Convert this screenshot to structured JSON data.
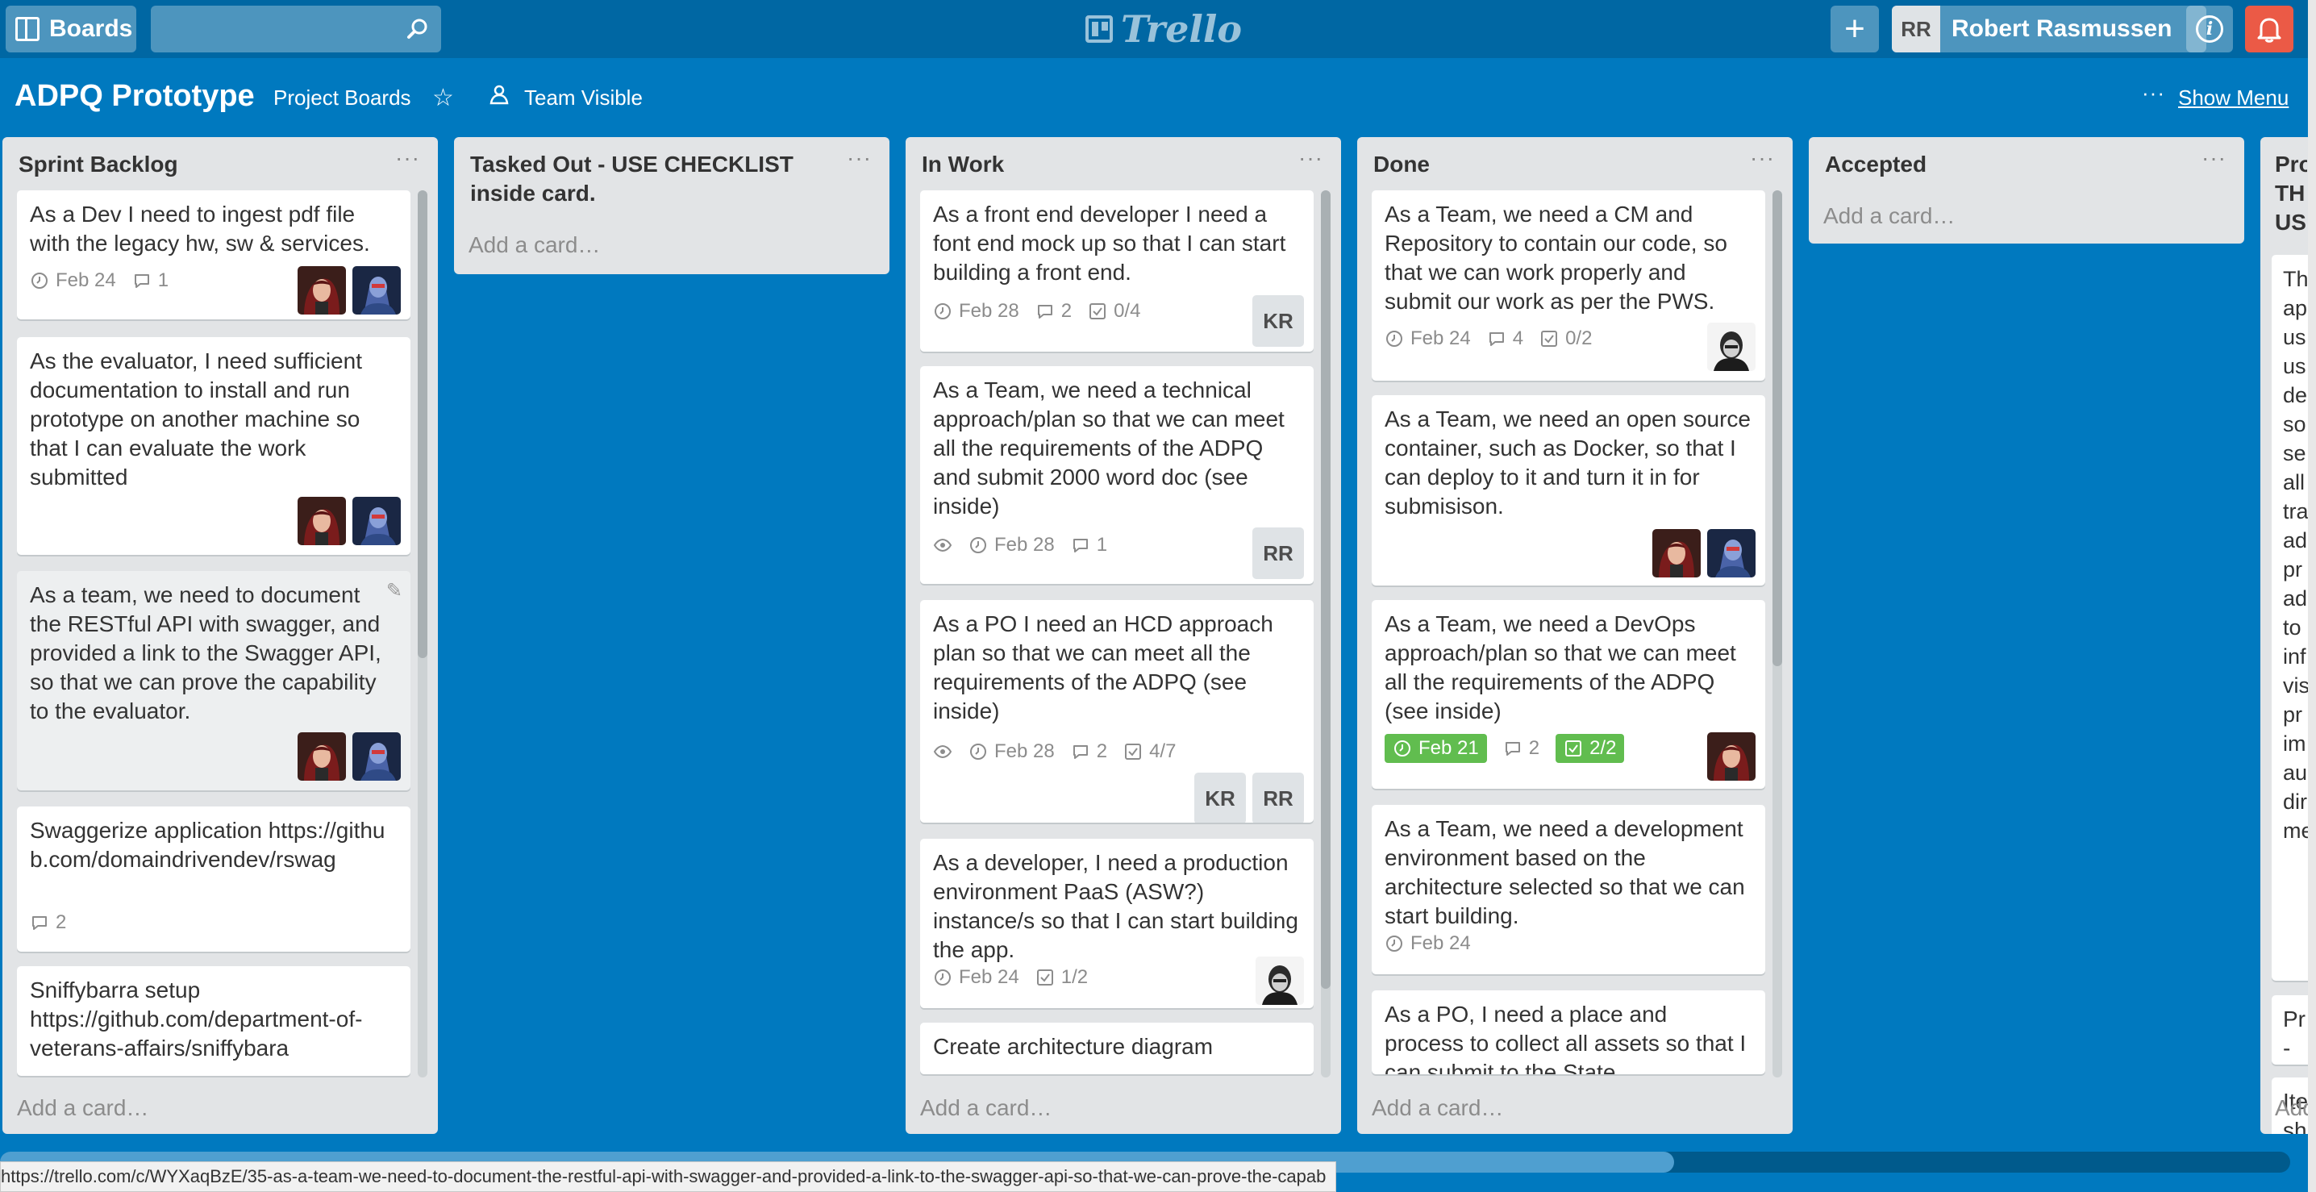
{
  "header": {
    "boards_label": "Boards",
    "search_placeholder": "",
    "logo_text": "Trello",
    "add_label": "+",
    "user_initials": "RR",
    "user_name": "Robert Rasmussen"
  },
  "board": {
    "title": "ADPQ Prototype",
    "org_link": "Project Boards",
    "visibility": "Team Visible",
    "menu_dots": "···",
    "show_menu": "Show Menu"
  },
  "lists": [
    {
      "title": "Sprint Backlog",
      "add_card": "Add a card…",
      "cards": [
        {
          "text": "As a Dev I need to ingest pdf file with the legacy hw, sw & services.",
          "due": "Feb 24",
          "comments": "1"
        },
        {
          "text": "As the evaluator, I need sufficient documentation to install and run prototype on another machine so that I can evaluate the work submitted"
        },
        {
          "text": "As a team, we need to document the RESTful API with swagger, and provided a link to the Swagger API, so that we can prove the capability to the evaluator."
        },
        {
          "text": "Swaggerize application https://github.com/domaindrivendev/rswag",
          "comments": "2"
        },
        {
          "text": "Sniffybarra setup https://github.com/department-of-veterans-affairs/sniffybara"
        }
      ]
    },
    {
      "title": "Tasked Out - USE CHECKLIST inside card.",
      "add_card": "Add a card…",
      "cards": []
    },
    {
      "title": "In Work",
      "add_card": "Add a card…",
      "cards": [
        {
          "text": "As a front end developer I need a font end mock up so that I can start building a front end.",
          "due": "Feb 28",
          "comments": "2",
          "checklist": "0/4",
          "member": "KR"
        },
        {
          "text": "As a Team, we need a technical approach/plan so that we can meet all the requirements of the ADPQ and submit 2000 word doc (see inside)",
          "due": "Feb 28",
          "comments": "1",
          "member": "RR"
        },
        {
          "text": "As a PO I need an HCD approach plan so that we can meet all the requirements of the ADPQ (see inside)",
          "due": "Feb 28",
          "comments": "2",
          "checklist": "4/7",
          "members": [
            "KR",
            "RR"
          ]
        },
        {
          "text": "As a developer, I need a production environment PaaS (ASW?) instance/s so that I can start building the app.",
          "due": "Feb 24",
          "checklist": "1/2"
        },
        {
          "text": "Create architecture diagram"
        }
      ]
    },
    {
      "title": "Done",
      "add_card": "Add a card…",
      "cards": [
        {
          "text": "As a Team, we need a CM and Repository to contain our code, so that we can work properly and submit our work as per the PWS.",
          "due": "Feb 24",
          "comments": "4",
          "checklist": "0/2"
        },
        {
          "text": "As a Team, we need an open source container, such as Docker, so that I can deploy to it and turn it in for submisison."
        },
        {
          "text": "As a Team, we need a DevOps approach/plan so that we can meet all the requirements of the ADPQ (see inside)",
          "due": "Feb 21",
          "comments": "2",
          "checklist": "2/2"
        },
        {
          "text": "As a Team, we need a development environment based on the architecture selected so that we can start building.",
          "due": "Feb 24"
        },
        {
          "text": "As a PO, I need a place and process to collect all assets so that I can submit to the State."
        }
      ]
    },
    {
      "title": "Accepted",
      "add_card": "Add a card…",
      "cards": []
    },
    {
      "title": "Pro TH US",
      "add_card": "Add",
      "cards": [
        {
          "text": "Th ap us us de so se all tra ad pr ad to inf vis pr im au dir me"
        },
        {
          "text": "Pr - v"
        },
        {
          "text": "Ite sh"
        },
        {
          "text": "Pr"
        }
      ]
    }
  ],
  "status_url": "https://trello.com/c/WYXaqBzE/35-as-a-team-we-need-to-document-the-restful-api-with-swagger-and-provided-a-link-to-the-swagger-api-so-that-we-can-prove-the-capab",
  "colors": {
    "board_bg": "#0079bf",
    "header_bg": "#0067a3",
    "list_bg": "#e2e4e6",
    "due_complete": "#61bd4f",
    "notification": "#eb5a46"
  }
}
